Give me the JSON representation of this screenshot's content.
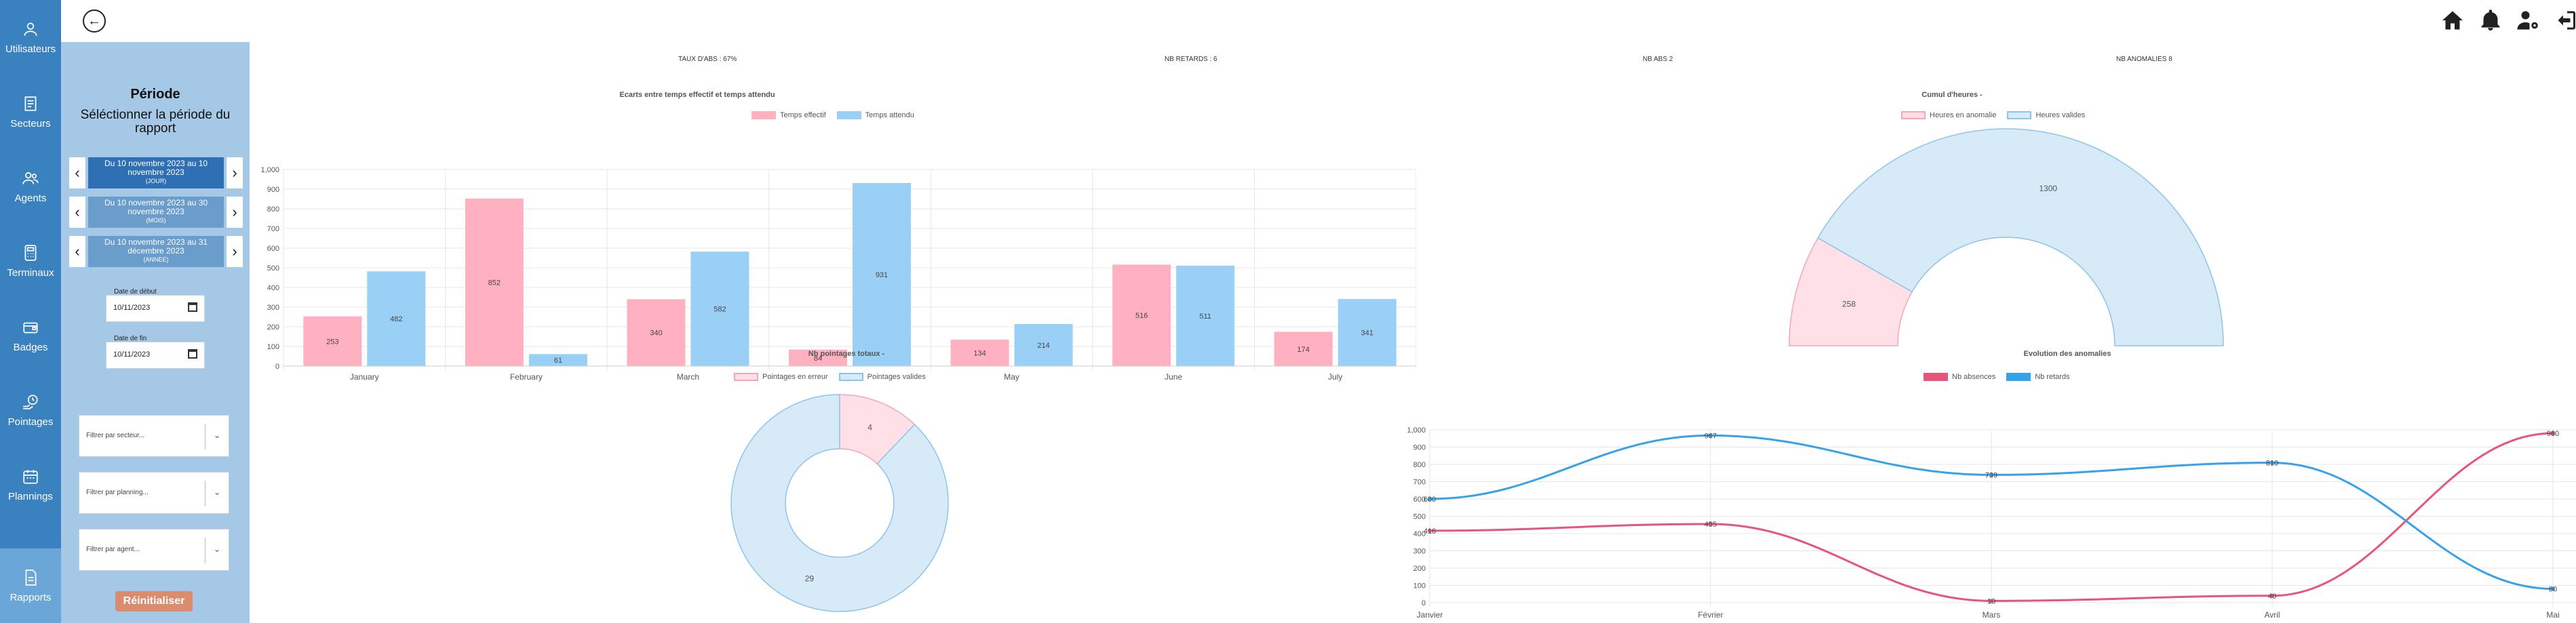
{
  "nav": {
    "items": [
      {
        "label": "Utilisateurs",
        "icon": "user-icon"
      },
      {
        "label": "Secteurs",
        "icon": "document-icon"
      },
      {
        "label": "Agents",
        "icon": "users-icon"
      },
      {
        "label": "Terminaux",
        "icon": "calculator-icon"
      },
      {
        "label": "Badges",
        "icon": "wallet-icon"
      },
      {
        "label": "Pointages",
        "icon": "clock-hand-icon"
      },
      {
        "label": "Plannings",
        "icon": "calendar-icon"
      },
      {
        "label": "Rapports",
        "icon": "report-icon",
        "active": true
      }
    ]
  },
  "period": {
    "title": "Période",
    "subtitle": "Séléctionner la période du rapport",
    "options": [
      {
        "line1": "Du 10 novembre 2023 au 10",
        "line2": "novembre 2023",
        "line3": "(JOUR)",
        "selected": true
      },
      {
        "line1": "Du 10 novembre 2023 au 30",
        "line2": "novembre 2023",
        "line3": "(MOIS)",
        "selected": false
      },
      {
        "line1": "Du 10 novembre 2023 au 31",
        "line2": "décembre 2023",
        "line3": "(ANNEE)",
        "selected": false
      }
    ],
    "start_label": "Date de début",
    "start_value": "10/11/2023",
    "end_label": "Date de fin",
    "end_value": "10/11/2023",
    "filters": [
      "Filtrer par secteur...",
      "Filtrer par planning...",
      "Filtrer par agent..."
    ],
    "reset_label": "Réinitialiser"
  },
  "stats": {
    "taux_abs": "TAUX D'ABS : 67%",
    "nb_retards": "NB RETARDS : 6",
    "nb_abs": "NB ABS 2",
    "nb_anomalies": "NB ANOMALIES 8"
  },
  "colors": {
    "pink_fill": "#ffb1c1",
    "pink_line": "#e8557a",
    "blue_fill": "#9ad0f5",
    "blue_line": "#36a2eb",
    "light_pink": "#ffe0e6",
    "light_blue": "#d6eaf8",
    "nav_bg": "#3a82bf",
    "panel_bg": "#a5c8e6",
    "reset_btn": "#d98c6e"
  },
  "chart_data": [
    {
      "type": "bar",
      "title": "Ecarts entre temps effectif et temps attendu",
      "categories": [
        "January",
        "February",
        "March",
        "April",
        "May",
        "June",
        "July"
      ],
      "series": [
        {
          "name": "Temps effectif",
          "values": [
            253,
            852,
            340,
            84,
            134,
            516,
            174
          ]
        },
        {
          "name": "Temps attendu",
          "values": [
            482,
            61,
            582,
            931,
            214,
            511,
            341
          ]
        }
      ],
      "ylim": [
        0,
        1000
      ],
      "yticks": [
        "0",
        "100",
        "200",
        "300",
        "400",
        "500",
        "600",
        "700",
        "800",
        "900",
        "1,000"
      ],
      "grid": true,
      "legend": "top"
    },
    {
      "type": "pie",
      "title": "Cumul d'heures -",
      "labels": [
        "Heures en anomalie",
        "Heures valides"
      ],
      "values": [
        258,
        1300
      ],
      "legend": "top"
    },
    {
      "type": "pie",
      "title": "Nb pointages totaux -",
      "labels": [
        "Pointages en erreur",
        "Pointages valides"
      ],
      "values": [
        4,
        29
      ],
      "legend": "top"
    },
    {
      "type": "line",
      "title": "Evolution des anomalies",
      "categories": [
        "Janvier",
        "Février",
        "Mars",
        "Avril",
        "Mai"
      ],
      "series": [
        {
          "name": "Nb absences",
          "values": [
            416,
            455,
            10,
            40,
            980
          ]
        },
        {
          "name": "Nb retards",
          "values": [
            600,
            967,
            739,
            810,
            80
          ]
        }
      ],
      "ylim": [
        0,
        1000
      ],
      "yticks": [
        "0",
        "100",
        "200",
        "300",
        "400",
        "500",
        "600",
        "700",
        "800",
        "900",
        "1,000"
      ],
      "grid": true,
      "legend": "top"
    }
  ]
}
